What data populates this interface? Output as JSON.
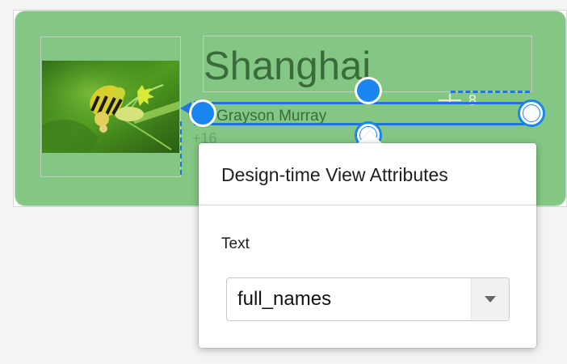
{
  "preview": {
    "title": "Shanghai",
    "name_text": "Grayson Murray",
    "secondary_text": "+16",
    "margin_value": "8"
  },
  "popup": {
    "title": "Design-time View Attributes",
    "field_label": "Text",
    "dropdown_value": "full_names"
  },
  "colors": {
    "card": "#84c784",
    "selection": "#1d73e8",
    "handle": "#1a86f0"
  },
  "icons": {
    "dropdown": "chevron-down-icon",
    "thumbnail": "caterpillar-photo"
  }
}
